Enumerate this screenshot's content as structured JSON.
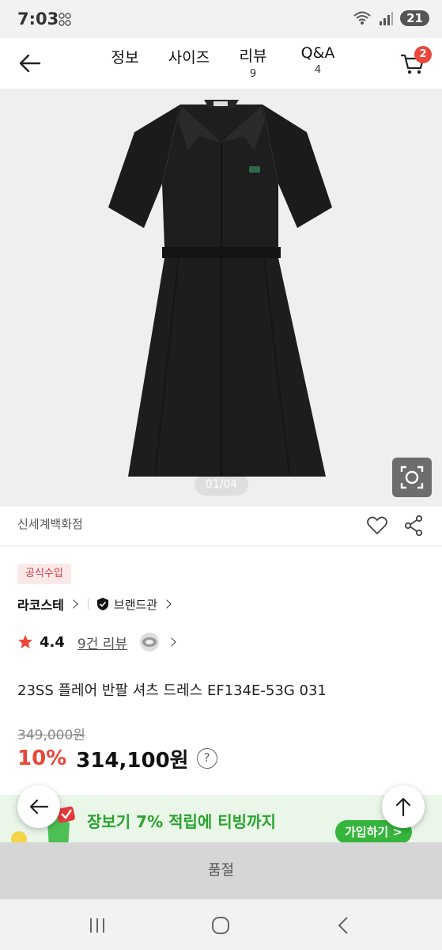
{
  "status_bar": {
    "time": "7:03",
    "battery": "21",
    "signal_label": "5"
  },
  "header": {
    "tabs": [
      {
        "label": "정보",
        "count": ""
      },
      {
        "label": "사이즈",
        "count": ""
      },
      {
        "label": "리뷰",
        "count": "9"
      },
      {
        "label": "Q&A",
        "count": "4"
      }
    ],
    "cart_count": "2"
  },
  "gallery": {
    "page_indicator": "01/04",
    "image_icon": "dress-photo"
  },
  "store": {
    "name": "신세계백화점",
    "like_icon": "heart-icon",
    "share_icon": "share-icon"
  },
  "badge": {
    "official": "공식수입"
  },
  "brand": {
    "name": "라코스테",
    "hall_label": "브랜드관"
  },
  "rating": {
    "score": "4.4",
    "review_link": "9건 리뷰"
  },
  "product": {
    "title": "23SS 플레어 반팔 셔츠 드레스 EF134E-53G 031",
    "original_price": "349,000원",
    "discount": "10%",
    "price": "314,100원",
    "help_icon": "?"
  },
  "promo": {
    "headline": "장보기 7% 적립에 티빙까지",
    "subline": "",
    "join_label": "가입하기 >"
  },
  "purchase": {
    "soldout_label": "품절"
  },
  "colors": {
    "accent_red": "#e8473a",
    "promo_green": "#2aa32f"
  }
}
